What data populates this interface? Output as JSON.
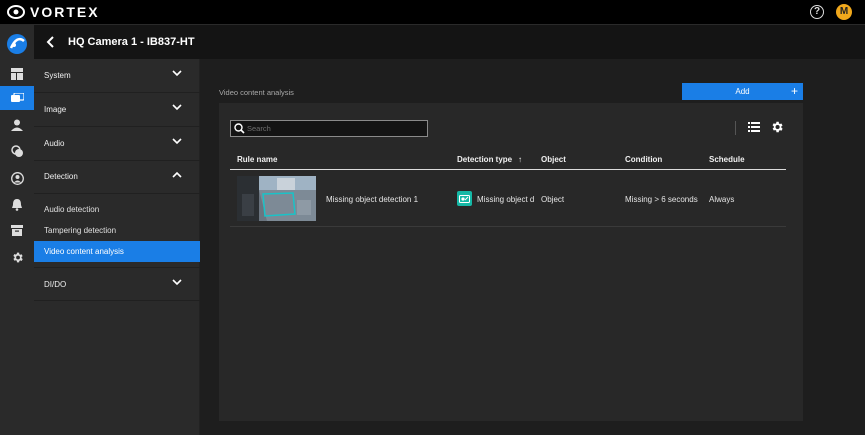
{
  "app": {
    "brand": "VORTEX",
    "help_symbol": "?",
    "user_initial": "M"
  },
  "rail": {
    "items": [
      {
        "icon": "logo-icon"
      },
      {
        "icon": "dashboard-icon"
      },
      {
        "icon": "devices-icon",
        "active": true
      },
      {
        "icon": "user-icon"
      },
      {
        "icon": "integrations-icon"
      },
      {
        "icon": "account-icon"
      },
      {
        "icon": "bell-icon"
      },
      {
        "icon": "archive-icon"
      },
      {
        "icon": "gear-icon"
      }
    ]
  },
  "header": {
    "title": "HQ Camera 1 - IB837-HT"
  },
  "sidebar": {
    "sections": [
      {
        "label": "System"
      },
      {
        "label": "Image"
      },
      {
        "label": "Audio"
      },
      {
        "label": "Detection",
        "expanded": true
      },
      {
        "label": "DI/DO"
      }
    ],
    "detection_items": [
      {
        "label": "Audio detection"
      },
      {
        "label": "Tampering detection"
      },
      {
        "label": "Video content analysis",
        "active": true
      }
    ]
  },
  "main": {
    "section_title": "Video content analysis",
    "add_label": "Add",
    "add_symbol": "+",
    "search": {
      "placeholder": "Search",
      "value": ""
    },
    "table": {
      "columns": [
        {
          "label": "Rule name"
        },
        {
          "label": "Detection type",
          "sort": "asc",
          "sort_symbol": "↑"
        },
        {
          "label": "Object"
        },
        {
          "label": "Condition"
        },
        {
          "label": "Schedule"
        }
      ],
      "rows": [
        {
          "rule_name": "Missing object detection 1",
          "detection_type": "Missing object d",
          "object": "Object",
          "condition": "Missing > 6 seconds",
          "schedule": "Always"
        }
      ]
    }
  },
  "colors": {
    "accent": "#1a7ee6",
    "avatar": "#f0a81c",
    "detection_icon": "#15b8a6"
  }
}
